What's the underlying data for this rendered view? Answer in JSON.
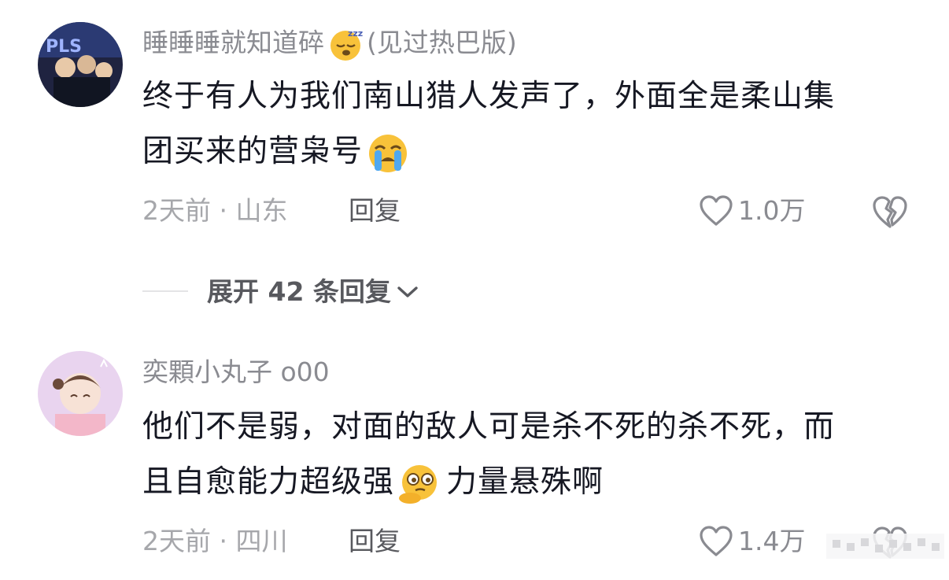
{
  "comments": [
    {
      "username": "睡睡睡就知道碎",
      "username_suffix": "(见过热巴版)",
      "username_emoji": "sleeping-face",
      "text_line1": "终于有人为我们南山猎人发声了，外面全是柔山集",
      "text_line2": "团买来的营枭号",
      "text_emoji": "loudly-crying-face",
      "time": "2天前",
      "location": "山东",
      "reply_label": "回复",
      "likes": "1.0万",
      "avatar_colors": [
        "#1f2340",
        "#3b4d8f",
        "#e8c9a8"
      ]
    },
    {
      "username": "奕顆小丸子 o00",
      "text_line1": "他们不是弱，对面的敌人可是杀不死的杀不死，而",
      "text_line2": "且自愈能力超级强",
      "text_emoji": "thinking-face",
      "text_line2_tail": "力量悬殊啊",
      "time": "2天前",
      "location": "四川",
      "reply_label": "回复",
      "likes": "1.4万",
      "avatar_colors": [
        "#e9d4ef",
        "#f3c7d6",
        "#6b4a3a"
      ]
    }
  ],
  "expand": {
    "label": "展开 42 条回复"
  },
  "meta_separator": " · "
}
